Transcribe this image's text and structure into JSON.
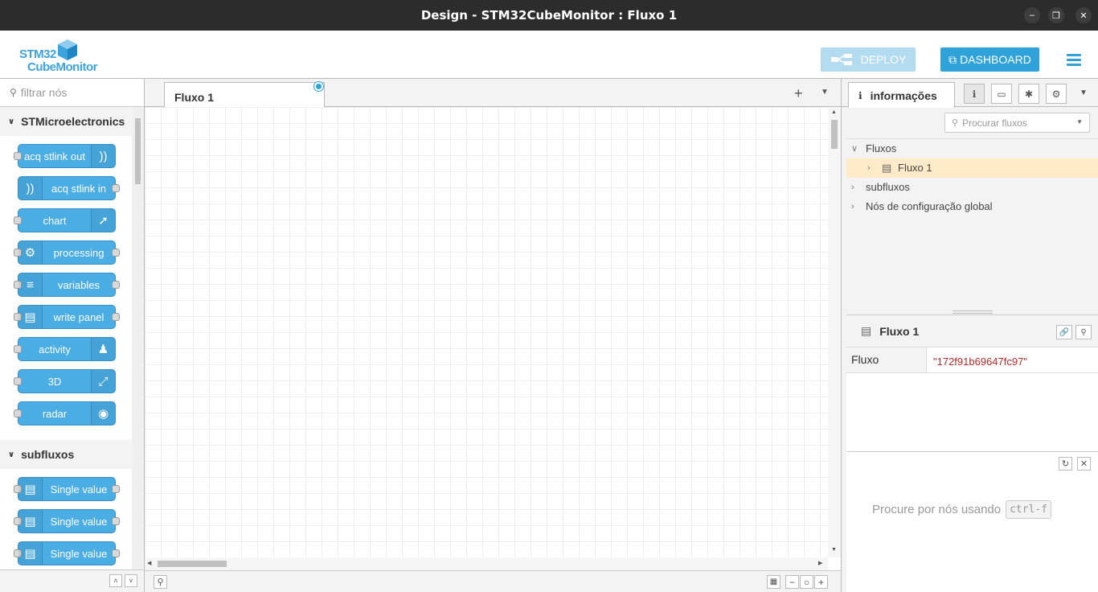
{
  "window": {
    "title": "Design - STM32CubeMonitor : Fluxo 1"
  },
  "header": {
    "logo_line1": "STM32",
    "logo_line2": "CubeMonitor",
    "deploy_label": "DEPLOY",
    "dashboard_label": "DASHBOARD"
  },
  "palette": {
    "search_placeholder": "filtrar nós",
    "categories": [
      {
        "name": "STMicroelectronics",
        "nodes": [
          "acq stlink out",
          "acq stlink in",
          "chart",
          "processing",
          "variables",
          "write panel",
          "activity",
          "3D",
          "radar"
        ]
      },
      {
        "name": "subfluxos",
        "nodes": [
          "Single value",
          "Single value",
          "Single value"
        ]
      }
    ]
  },
  "workspace": {
    "tab_label": "Fluxo 1"
  },
  "sidebar": {
    "tab_label": "informações",
    "search_placeholder": "Procurar fluxos",
    "tree": {
      "flows": "Fluxos",
      "flow_item": "Fluxo 1",
      "subflows": "subfluxos",
      "global_config": "Nós de configuração global"
    },
    "info": {
      "title": "Fluxo 1",
      "key": "Fluxo",
      "value": "\"172f91b69647fc97\""
    },
    "help": {
      "text": "Procure por nós usando",
      "shortcut": "ctrl-f"
    }
  },
  "colors": {
    "accent": "#2fa3d9",
    "node": "#4aaee5",
    "selection": "#ffebc7",
    "value": "#b52a2a"
  }
}
